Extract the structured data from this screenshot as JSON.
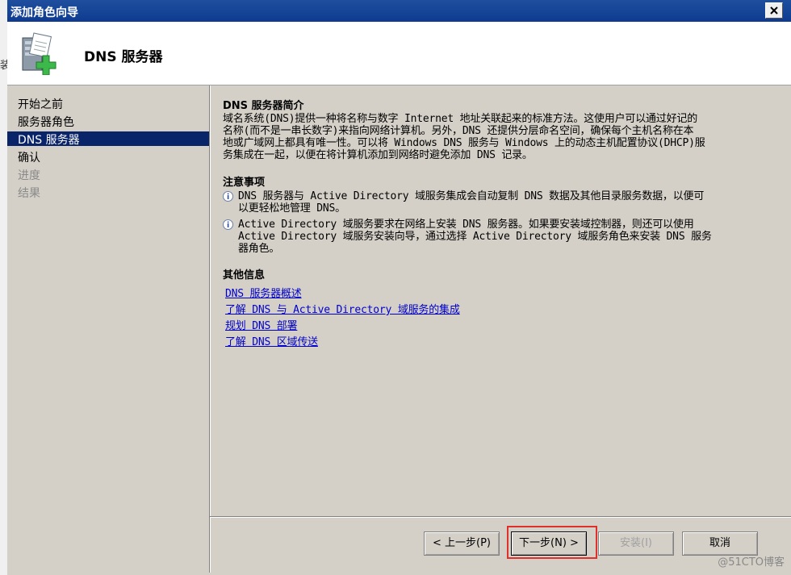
{
  "background": {
    "fragment": "装"
  },
  "window": {
    "title": "添加角色向导"
  },
  "header": {
    "title": "DNS  服务器",
    "icon": "server-add-icon"
  },
  "nav": {
    "items": [
      {
        "label": "开始之前",
        "state": "normal"
      },
      {
        "label": "服务器角色",
        "state": "normal"
      },
      {
        "label": "DNS 服务器",
        "state": "current"
      },
      {
        "label": "确认",
        "state": "normal"
      },
      {
        "label": "进度",
        "state": "disabled"
      },
      {
        "label": "结果",
        "state": "disabled"
      }
    ]
  },
  "content": {
    "intro_heading": "DNS 服务器简介",
    "intro_lines": [
      "域名系统(DNS)提供一种将名称与数字 Internet 地址关联起来的标准方法。这使用户可以通过好记的",
      "名称(而不是一串长数字)来指向网络计算机。另外，DNS 还提供分层命名空间，确保每个主机名称在本",
      "地或广域网上都具有唯一性。可以将 Windows DNS 服务与 Windows 上的动态主机配置协议(DHCP)服",
      "务集成在一起，以便在将计算机添加到网络时避免添加 DNS 记录。"
    ],
    "notes_heading": "注意事项",
    "notes": [
      {
        "lines": [
          "DNS 服务器与 Active Directory 域服务集成会自动复制 DNS 数据及其他目录服务数据，以便可",
          "以更轻松地管理 DNS。"
        ]
      },
      {
        "lines": [
          "Active Directory 域服务要求在网络上安装 DNS 服务器。如果要安装域控制器，则还可以使用",
          "Active Directory 域服务安装向导，通过选择 Active Directory 域服务角色来安装 DNS 服务",
          "器角色。"
        ]
      }
    ],
    "more_heading": "其他信息",
    "links": [
      "DNS 服务器概述",
      "了解 DNS 与 Active Directory 域服务的集成",
      "规划 DNS 部署",
      "了解 DNS 区域传送"
    ]
  },
  "buttons": {
    "prev": "< 上一步(P)",
    "next": "下一步(N) >",
    "install": "安装(I)",
    "cancel": "取消"
  },
  "watermark": "@51CTO博客",
  "colors": {
    "titlebar": "#0e3b8f",
    "selected": "#0a246a",
    "link": "#0000cc",
    "highlight": "#e0302c"
  }
}
